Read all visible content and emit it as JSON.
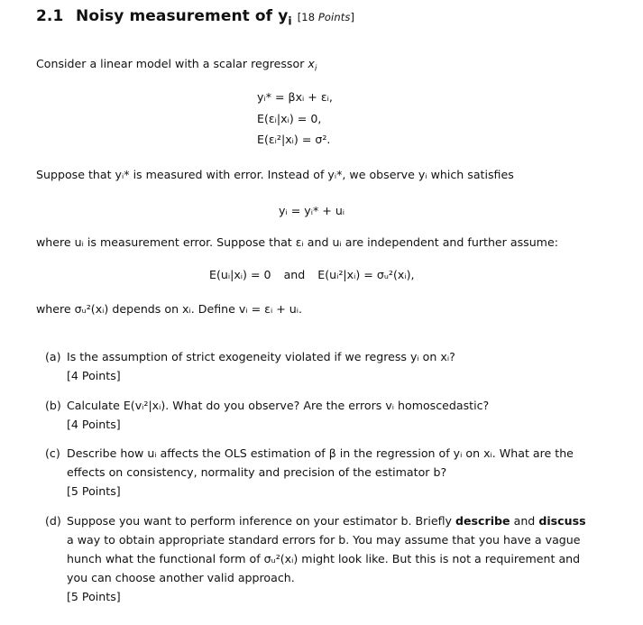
{
  "section": {
    "number": "2.1",
    "title_text": "Noisy measurement of ",
    "title_var": "y",
    "title_sub": "i",
    "points": "[18 ",
    "points_word": "Points",
    "points_close": "]"
  },
  "intro": {
    "text": "Consider a linear model with a scalar regressor ",
    "var": "x",
    "sub": "i"
  },
  "model_equations": [
    "yᵢ* = βxᵢ + εᵢ,",
    "E(εᵢ|xᵢ) = 0,",
    "E(εᵢ²|xᵢ) = σ²."
  ],
  "measurement_paragraph": "Suppose that yᵢ* is measured with error. Instead of yᵢ*, we observe yᵢ which satisfies",
  "measurement_equation": "yᵢ = yᵢ* + uᵢ",
  "assumption_paragraph": "where uᵢ is measurement error. Suppose that εᵢ and uᵢ are independent and further assume:",
  "assumption_equation": {
    "left": "E(uᵢ|xᵢ) = 0",
    "connector": "and",
    "right": "E(uᵢ²|xᵢ) = σᵤ²(xᵢ),"
  },
  "definition_paragraph": "where σᵤ²(xᵢ) depends on xᵢ. Define vᵢ = εᵢ + uᵢ.",
  "questions": [
    {
      "label": "(a)",
      "text": "Is the assumption of strict exogeneity violated if we regress yᵢ on xᵢ?",
      "points": "[4 Points]"
    },
    {
      "label": "(b)",
      "text": "Calculate E(vᵢ²|xᵢ). What do you observe? Are the errors vᵢ homoscedastic?",
      "points": "[4 Points]"
    },
    {
      "label": "(c)",
      "text": "Describe how uᵢ affects the OLS estimation of β in the regression of yᵢ on xᵢ. What are the effects on consistency, normality and precision of the estimator b?",
      "points": "[5 Points]"
    },
    {
      "label": "(d)",
      "text_pre": "Suppose you want to perform inference on your estimator b. Briefly ",
      "bold1": "describe",
      "text_mid": " and ",
      "bold2": "discuss",
      "text_post": " a way to obtain appropriate standard errors for b. You may assume that you have a vague hunch what the functional form of σᵤ²(xᵢ) might look like. But this is not a requirement and you can choose another valid approach.",
      "points": "[5 Points]"
    }
  ]
}
